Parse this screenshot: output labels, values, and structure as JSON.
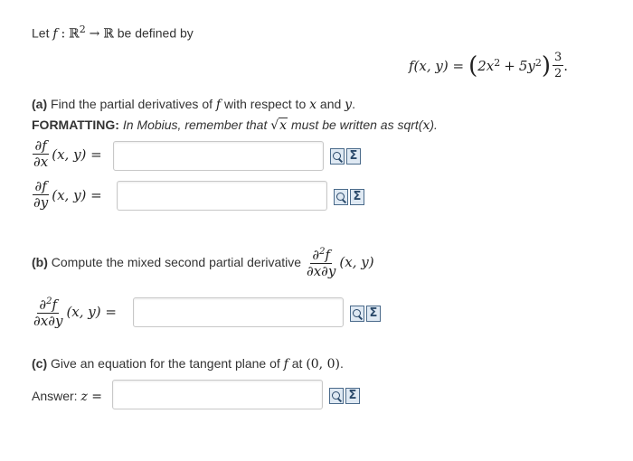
{
  "intro": {
    "prefix": "Let",
    "f": "f",
    "colon": ":",
    "domain": "ℝ",
    "domain_exp": "2",
    "arrow": "→",
    "codomain": "ℝ",
    "suffix": "be defined by"
  },
  "function_def": {
    "lhs": "f(x, y) =",
    "base_open": "(",
    "term1": "2x",
    "term1_exp": "2",
    "plus": "+",
    "term2": "5y",
    "term2_exp": "2",
    "base_close": ")",
    "exp_num": "3",
    "exp_den": "2",
    "end": "."
  },
  "part_a": {
    "label": "(a)",
    "text": "Find the partial derivatives of",
    "f": "f",
    "text2": "with respect to",
    "x": "x",
    "and": "and",
    "y": "y",
    "end": ".",
    "formatting_label": "FORMATTING:",
    "formatting_text": "In Mobius, remember that",
    "sqrt_arg": "x",
    "formatting_text2": "must be written as sqrt(",
    "formatting_arg": "x",
    "formatting_close": ").",
    "dfdx": {
      "num": "∂f",
      "den": "∂x",
      "args": "(x, y) =",
      "value": ""
    },
    "dfdy": {
      "num": "∂f",
      "den": "∂y",
      "args": "(x, y) =",
      "value": ""
    }
  },
  "part_b": {
    "label": "(b)",
    "text": "Compute the mixed second partial derivative",
    "num": "∂",
    "num_exp": "2",
    "num_f": "f",
    "den": "∂x∂y",
    "args": "(x, y)",
    "answer": {
      "num": "∂",
      "num_exp": "2",
      "num_f": "f",
      "den": "∂x∂y",
      "args": "(x, y) =",
      "value": ""
    }
  },
  "part_c": {
    "label": "(c)",
    "text": "Give an equation for the tangent plane of",
    "f": "f",
    "at": "at",
    "point": "(0, 0)",
    "end": ".",
    "answer_label": "Answer:",
    "z": "z =",
    "value": ""
  },
  "icons": {
    "preview": "preview-icon",
    "entry": "equation-editor-icon",
    "entry_glyph": "Σ"
  }
}
